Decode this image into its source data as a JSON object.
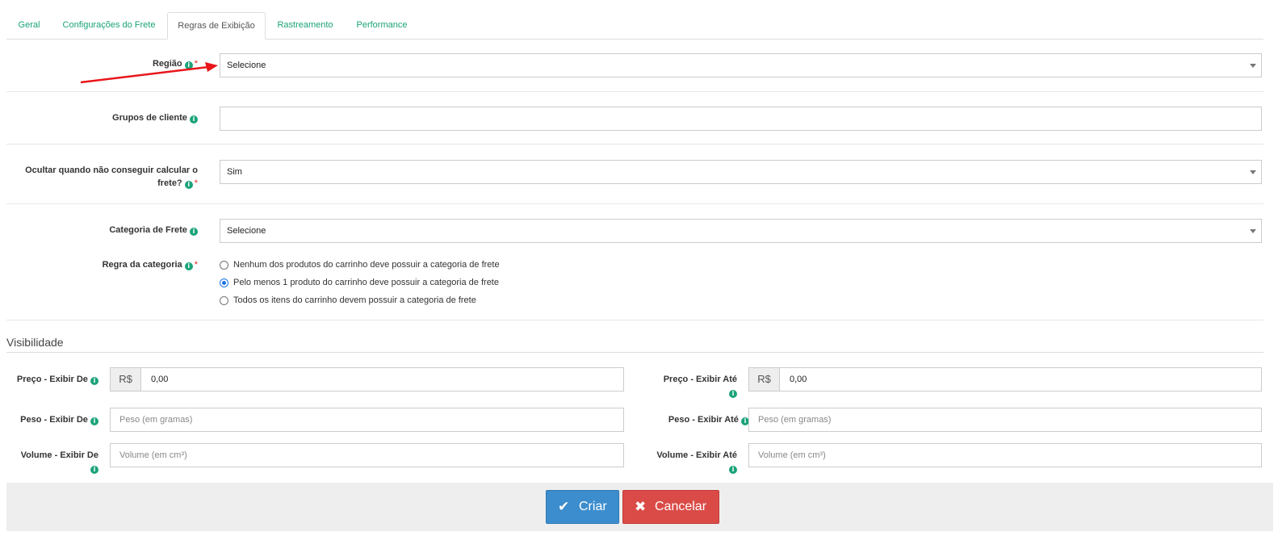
{
  "tabs": [
    {
      "label": "Geral"
    },
    {
      "label": "Configurações do Frete"
    },
    {
      "label": "Regras de Exibição"
    },
    {
      "label": "Rastreamento"
    },
    {
      "label": "Performance"
    }
  ],
  "info_icon": "i",
  "required_mark": "*",
  "fields": {
    "regiao": {
      "label": "Região",
      "value": "Selecione"
    },
    "grupos": {
      "label": "Grupos de cliente",
      "value": ""
    },
    "ocultar": {
      "label_line1": "Ocultar quando não conseguir calcular o",
      "label_line2": "frete?",
      "value": "Sim"
    },
    "categoria": {
      "label": "Categoria de Frete",
      "value": "Selecione"
    },
    "regra": {
      "label": "Regra da categoria",
      "options": [
        {
          "label": "Nenhum dos produtos do carrinho deve possuir a categoria de frete",
          "checked": false
        },
        {
          "label": "Pelo menos 1 produto do carrinho deve possuir a categoria de frete",
          "checked": true
        },
        {
          "label": "Todos os itens do carrinho devem possuir a categoria de frete",
          "checked": false
        }
      ]
    }
  },
  "visibility": {
    "title": "Visibilidade",
    "currency": "R$",
    "preco_de": {
      "label": "Preço - Exibir De",
      "value": "0,00"
    },
    "preco_ate": {
      "label": "Preço - Exibir Até",
      "value": "0,00"
    },
    "peso_de": {
      "label": "Peso - Exibir De",
      "placeholder": "Peso (em gramas)"
    },
    "peso_ate": {
      "label": "Peso - Exibir Até",
      "placeholder": "Peso (em gramas)"
    },
    "volume_de": {
      "label": "Volume - Exibir De",
      "placeholder": "Volume (em cm³)"
    },
    "volume_ate": {
      "label": "Volume - Exibir Até",
      "placeholder": "Volume (em cm³)"
    }
  },
  "buttons": {
    "create": {
      "label": "Criar",
      "icon": "✔"
    },
    "cancel": {
      "label": "Cancelar",
      "icon": "✖"
    }
  },
  "colors": {
    "accent": "#1aa37a",
    "primary": "#3c8dcd",
    "danger": "#da4b47",
    "required": "#e02424",
    "annotation_arrow": "#e8161b"
  }
}
